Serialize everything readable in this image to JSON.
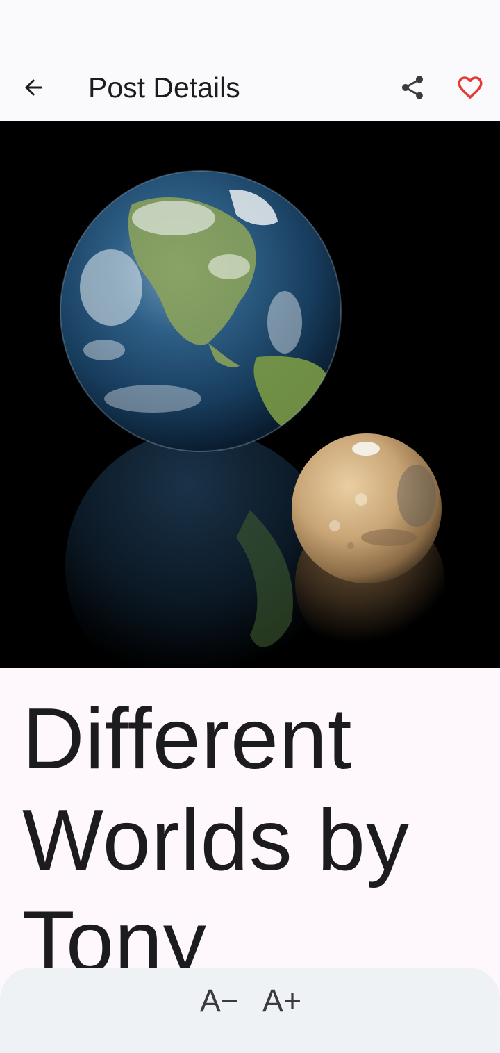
{
  "app_bar": {
    "title": "Post Details",
    "back_icon": "arrow-back-icon",
    "share_icon": "share-icon",
    "favorite_icon": "heart-outline-icon",
    "favorite_color": "#e53935"
  },
  "post": {
    "image_icon": "earth-mars-image",
    "title": "Different Worlds by Tony"
  },
  "font_controls": {
    "decrease_label": "A−",
    "increase_label": "A+"
  },
  "colors": {
    "background": "#fef7fb",
    "app_bar": "#fafafc",
    "bottom_panel": "#eef2f5",
    "text": "#1c1b1f"
  }
}
